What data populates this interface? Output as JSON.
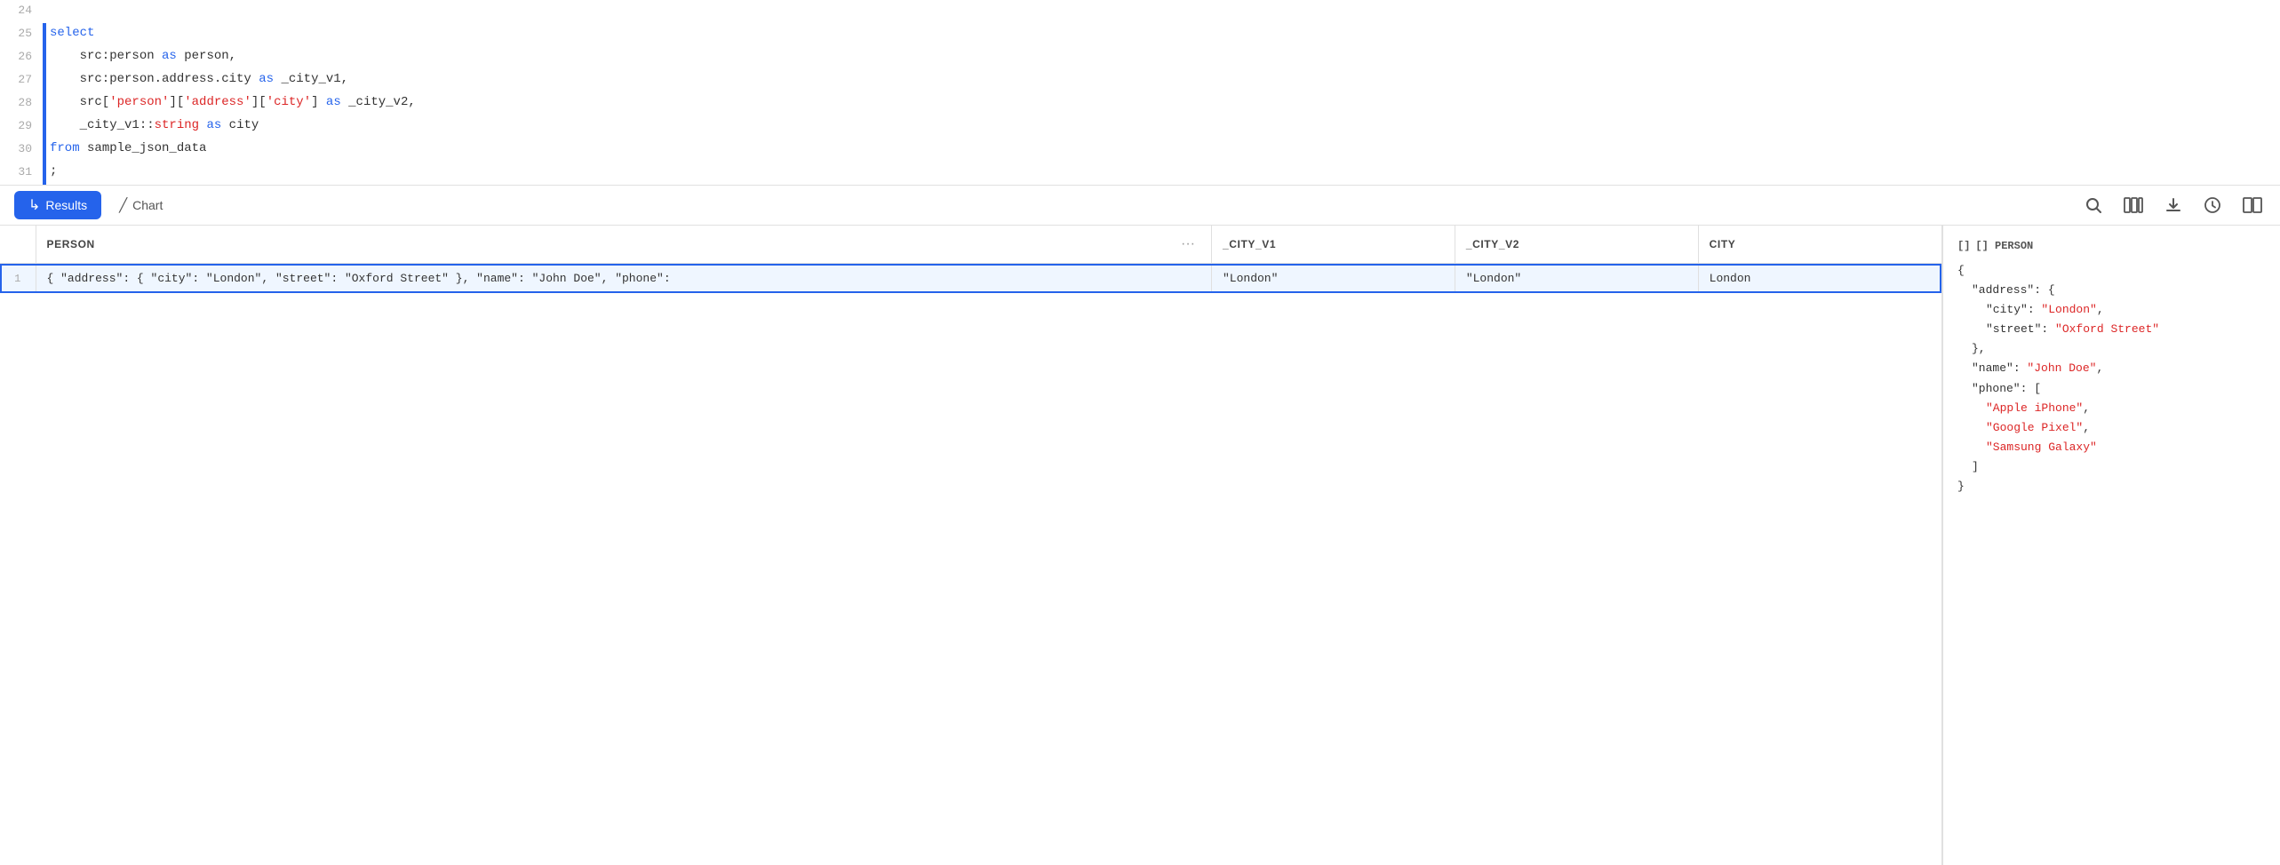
{
  "code": {
    "lines": [
      {
        "num": 24,
        "hasBar": false,
        "tokens": []
      },
      {
        "num": 25,
        "hasBar": true,
        "tokens": [
          {
            "type": "kw",
            "text": "select"
          }
        ]
      },
      {
        "num": 26,
        "hasBar": true,
        "tokens": [
          {
            "type": "plain",
            "text": "    src:person "
          },
          {
            "type": "kw",
            "text": "as"
          },
          {
            "type": "plain",
            "text": " person,"
          }
        ]
      },
      {
        "num": 27,
        "hasBar": true,
        "tokens": [
          {
            "type": "plain",
            "text": "    src:person.address.city "
          },
          {
            "type": "kw",
            "text": "as"
          },
          {
            "type": "plain",
            "text": " _city_v1,"
          }
        ]
      },
      {
        "num": 28,
        "hasBar": true,
        "tokens": [
          {
            "type": "plain",
            "text": "    src["
          },
          {
            "type": "str",
            "text": "'person'"
          },
          {
            "type": "plain",
            "text": "]["
          },
          {
            "type": "str",
            "text": "'address'"
          },
          {
            "type": "plain",
            "text": "]["
          },
          {
            "type": "str",
            "text": "'city'"
          },
          {
            "type": "plain",
            "text": "] "
          },
          {
            "type": "kw",
            "text": "as"
          },
          {
            "type": "plain",
            "text": " _city_v2,"
          }
        ]
      },
      {
        "num": 29,
        "hasBar": true,
        "tokens": [
          {
            "type": "plain",
            "text": "    _city_v1::"
          },
          {
            "type": "kw-red",
            "text": "string"
          },
          {
            "type": "plain",
            "text": " "
          },
          {
            "type": "kw",
            "text": "as"
          },
          {
            "type": "plain",
            "text": " city"
          }
        ]
      },
      {
        "num": 30,
        "hasBar": true,
        "tokens": [
          {
            "type": "kw",
            "text": "from"
          },
          {
            "type": "plain",
            "text": " sample_json_data"
          }
        ]
      },
      {
        "num": 31,
        "hasBar": true,
        "tokens": [
          {
            "type": "plain",
            "text": ";"
          }
        ]
      }
    ]
  },
  "toolbar": {
    "results_label": "Results",
    "chart_label": "Chart",
    "arrow_icon": "↳"
  },
  "table": {
    "columns": [
      {
        "key": "row_num",
        "label": ""
      },
      {
        "key": "person",
        "label": "PERSON"
      },
      {
        "key": "city_v1",
        "label": "_CITY_V1"
      },
      {
        "key": "city_v2",
        "label": "_CITY_V2"
      },
      {
        "key": "city",
        "label": "CITY"
      }
    ],
    "rows": [
      {
        "num": 1,
        "person": "{ \"address\": {    \"city\": \"London\",    \"street\": \"Oxford Street\"  },  \"name\": \"John Doe\",  \"phone\":",
        "city_v1": "\"London\"",
        "city_v2": "\"London\"",
        "city": "London",
        "selected": true
      }
    ]
  },
  "json_panel": {
    "header": "[] PERSON",
    "content": {
      "address_city": "\"London\"",
      "address_street": "\"Oxford Street\"",
      "name": "\"John Doe\"",
      "phone_1": "\"Apple iPhone\"",
      "phone_2": "\"Google Pixel\"",
      "phone_3": "\"Samsung Galaxy\""
    }
  },
  "icons": {
    "search": "🔍",
    "columns": "⊞",
    "download": "⬇",
    "history": "🕐",
    "split": "⊟",
    "chart_line": "~",
    "bracket": "[]"
  }
}
